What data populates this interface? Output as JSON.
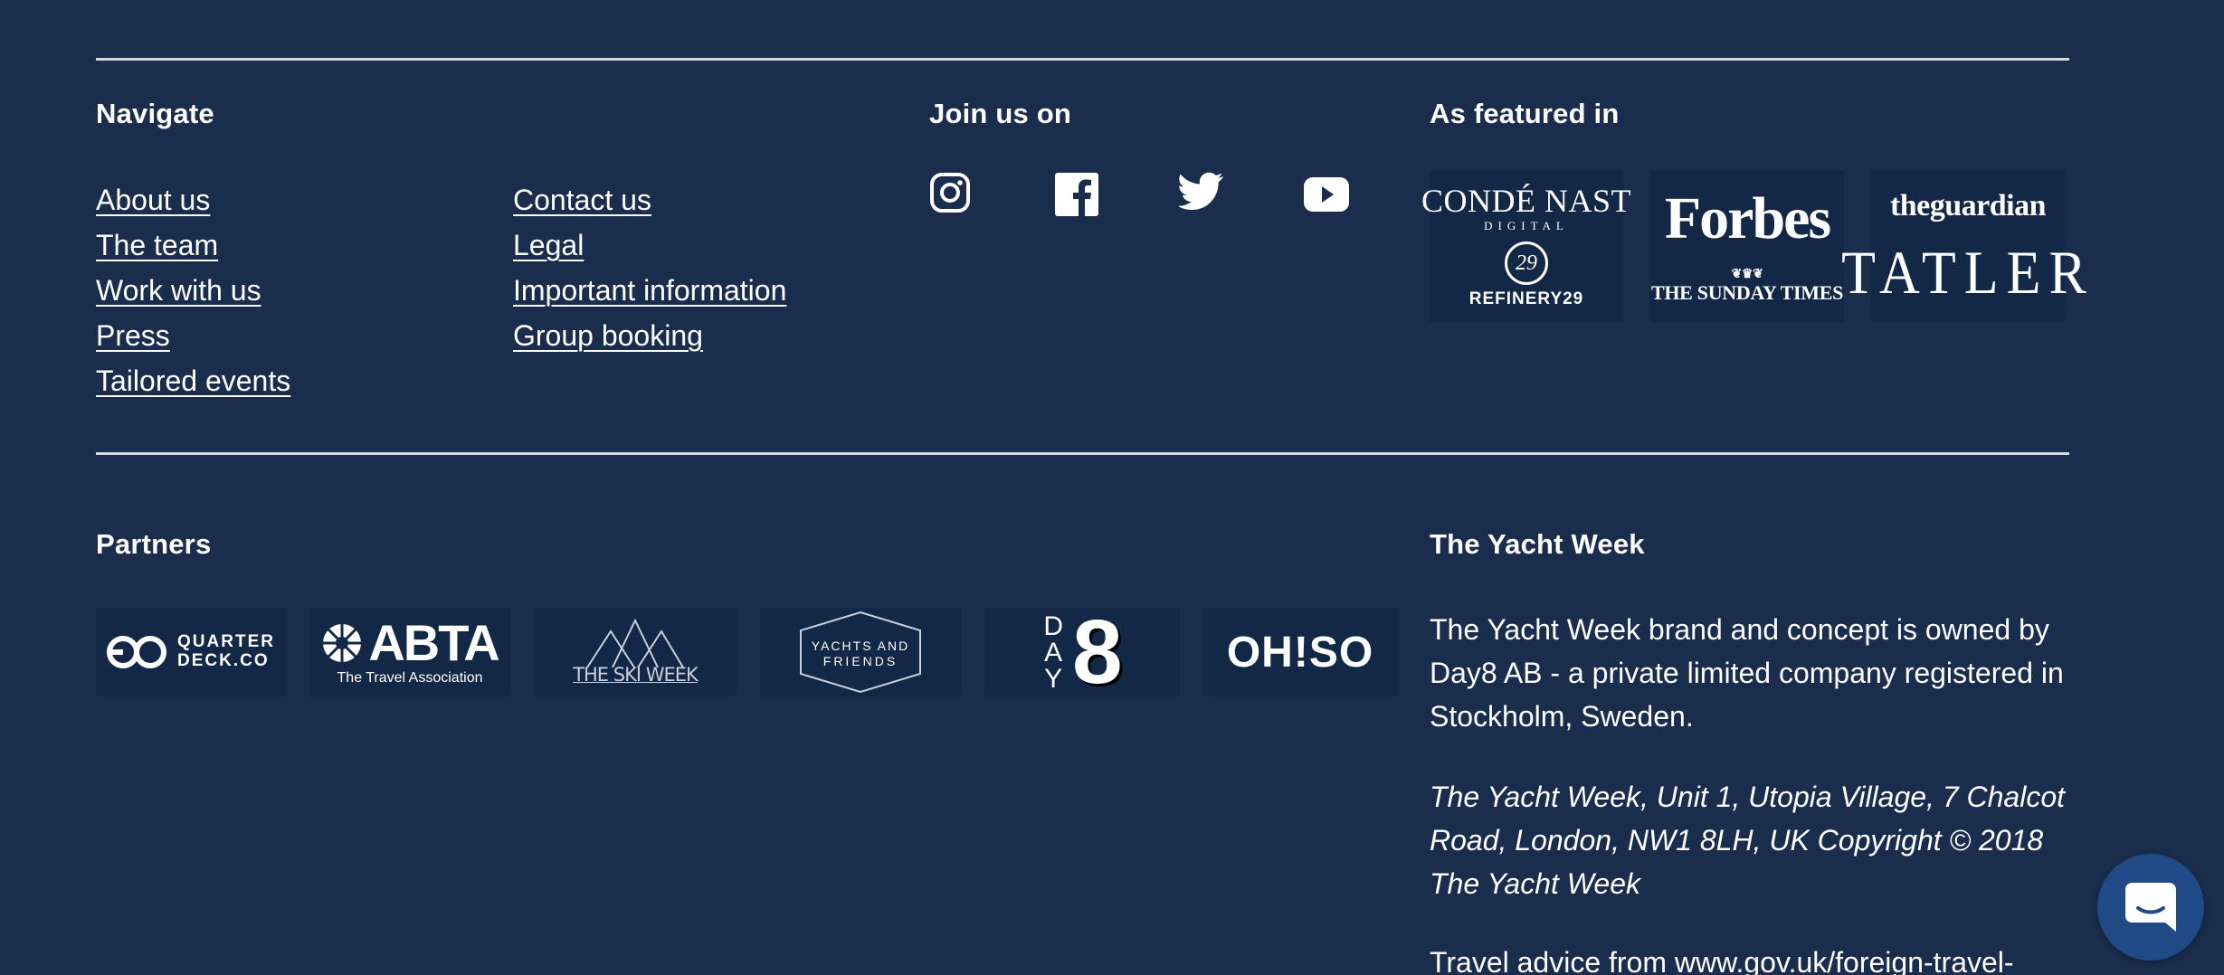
{
  "navigate": {
    "heading": "Navigate",
    "col1": [
      "About us",
      "The team",
      "Work with us",
      "Press",
      "Tailored events"
    ],
    "col2": [
      "Contact us",
      "Legal",
      "Important information",
      "Group booking"
    ]
  },
  "social": {
    "heading": "Join us on",
    "icons": [
      "instagram-icon",
      "facebook-icon",
      "twitter-icon",
      "youtube-icon"
    ]
  },
  "featured": {
    "heading": "As featured in",
    "logos": {
      "conde_nast": "CONDÉ NAST",
      "conde_nast_sub": "DIGITAL",
      "refinery29_mark": "29",
      "refinery29": "REFINERY29",
      "forbes": "Forbes",
      "sunday_times": "THE SUNDAY TIMES",
      "guardian": "theguardian",
      "tatler": "TATLER"
    }
  },
  "partners": {
    "heading": "Partners",
    "logos": {
      "quarterdeck_line1": "QUARTER",
      "quarterdeck_line2": "DECK.CO",
      "abta": "ABTA",
      "abta_sub": "The Travel Association",
      "ski_week": "THE SKI WEEK",
      "yachts_friends_line1": "YACHTS AND",
      "yachts_friends_line2": "FRIENDS",
      "day8_word": [
        "D",
        "A",
        "Y"
      ],
      "day8_number": "8",
      "ohso": "OH!SO"
    }
  },
  "yacht_week": {
    "heading": "The Yacht Week",
    "description": "The Yacht Week brand and concept is owned by Day8 AB - a private limited company registered in Stockholm, Sweden.",
    "address": "The Yacht Week, Unit 1, Utopia Village, 7 Chalcot Road, London, NW1 8LH, UK Copyright © 2018 The Yacht Week",
    "travel_advice": "Travel advice from www.gov.uk/foreign-travel-"
  },
  "chat": {
    "icon": "chat-bubble-icon"
  },
  "colors": {
    "background": "#1b2d4c",
    "tile": "#132746",
    "rule": "#d6dbe3",
    "chat": "#1f4a86"
  }
}
